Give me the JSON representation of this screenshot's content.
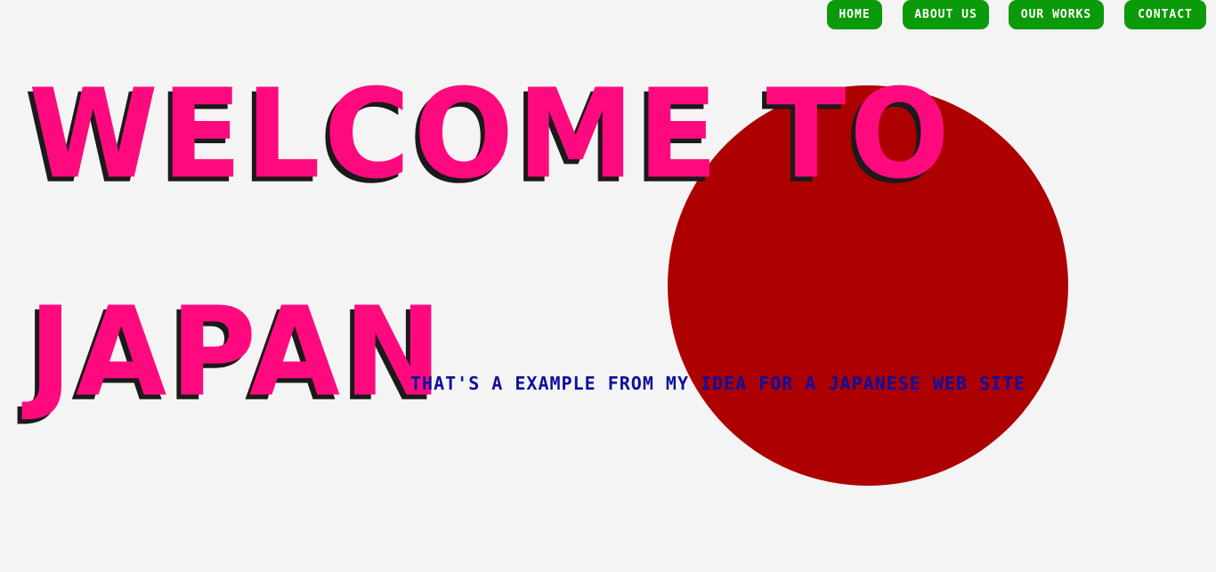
{
  "nav": {
    "items": [
      {
        "label": "Home"
      },
      {
        "label": "About us"
      },
      {
        "label": "Our works"
      },
      {
        "label": "Contact"
      }
    ]
  },
  "hero": {
    "title_line1": "Welcome to",
    "title_line2": "Japan",
    "tagline": "That's a example from my idea for a japanese web site"
  },
  "colors": {
    "background": "#f4f4f4",
    "sun": "#ad0000",
    "title": "#ff0a7e",
    "title_shadow": "#1a1a1a",
    "tagline": "#0f0f9c",
    "nav_button": "#0a9a0a",
    "nav_text": "#ffffff"
  }
}
